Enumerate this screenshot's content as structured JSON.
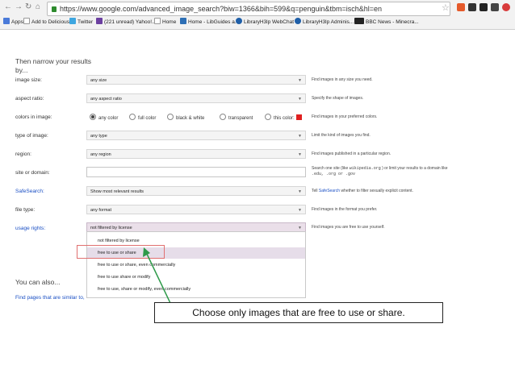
{
  "browser": {
    "url": "https://www.google.com/advanced_image_search?biw=1366&bih=599&q=penguin&tbm=isch&hl=en",
    "bookmarks": [
      "Apps",
      "Add to Delicious",
      "Twitter",
      "(221 unread) Yahoo!...",
      "Home",
      "Home - LibGuides a...",
      "LibraryH3lp WebChat",
      "LibraryH3lp Adminis...",
      "BBC News - Minecra..."
    ]
  },
  "section_title": "Then narrow your results by...",
  "rows": {
    "image_size": {
      "label": "image size:",
      "value": "any size",
      "hint": "Find images in any size you need."
    },
    "aspect_ratio": {
      "label": "aspect ratio:",
      "value": "any aspect ratio",
      "hint": "Specify the shape of images."
    },
    "colors": {
      "label": "colors in image:",
      "options": [
        "any color",
        "full color",
        "black & white",
        "transparent",
        "this color:"
      ],
      "selected": "any color",
      "swatch_color": "#e02020",
      "hint": "Find images in your preferred colors."
    },
    "type": {
      "label": "type of image:",
      "value": "any type",
      "hint": "Limit the kind of images you find."
    },
    "region": {
      "label": "region:",
      "value": "any region",
      "hint": "Find images published in a particular region."
    },
    "site": {
      "label": "site or domain:",
      "value": "",
      "hint_pre": "Search one site (like",
      "hint_code1": "wikipedia.org",
      "hint_mid": ") or limit your results to a domain like",
      "hint_code2": ".edu, .org or .gov"
    },
    "safesearch": {
      "label": "SafeSearch:",
      "value": "Show most relevant results",
      "hint_pre": "Tell",
      "hint_link": "SafeSearch",
      "hint_post": "whether to filter sexually explicit content."
    },
    "file_type": {
      "label": "file type:",
      "value": "any format",
      "hint": "Find images in the format you prefer."
    },
    "usage_rights": {
      "label": "usage rights:",
      "value": "not filtered by license",
      "hint": "Find images you are free to use yourself.",
      "options": [
        "not filtered by license",
        "free to use or share",
        "free to use or share, even commercially",
        "free to use share or modify",
        "free to use, share or modify, even commercially"
      ],
      "highlighted": "free to use or share"
    }
  },
  "you_can_also": "You can also...",
  "similar_link": "Find pages that are similar to,",
  "caption": "Choose only images that are free to use or share.",
  "colors": {
    "annotation_red": "#e07070",
    "arrow_green": "#2e9a4a"
  }
}
